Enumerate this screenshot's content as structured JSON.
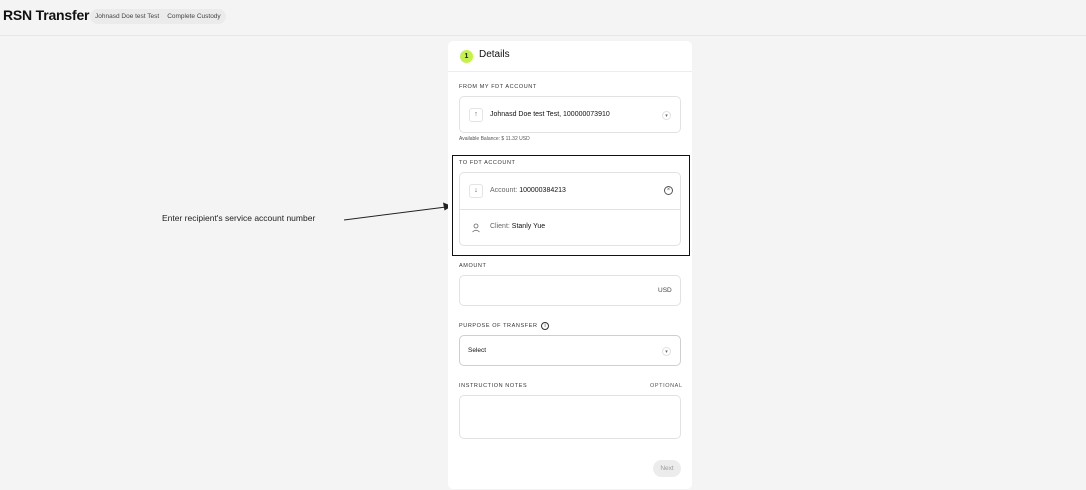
{
  "header": {
    "title": "RSN Transfer",
    "account_name": "Johnasd Doe test Test",
    "custody": "Complete Custody"
  },
  "step": {
    "number": "1",
    "title": "Details"
  },
  "from_account": {
    "label": "FROM MY FDT ACCOUNT",
    "icon": "arrow-up-icon",
    "value": "Johnasd Doe test Test, 100000073910",
    "balance": "Available Balance: $ 11.32 USD"
  },
  "to_account": {
    "label": "TO FDT ACCOUNT",
    "account_label": "Account:",
    "account_value": "100000384213",
    "client_label": "Client:",
    "client_value": "Stanly Yue"
  },
  "amount": {
    "label": "AMOUNT",
    "currency": "USD"
  },
  "purpose": {
    "label": "PURPOSE OF TRANSFER",
    "value": "Select"
  },
  "notes": {
    "label": "INSTRUCTION NOTES",
    "optional": "OPTIONAL"
  },
  "next_label": "Next",
  "annotation": "Enter recipient's service account number"
}
